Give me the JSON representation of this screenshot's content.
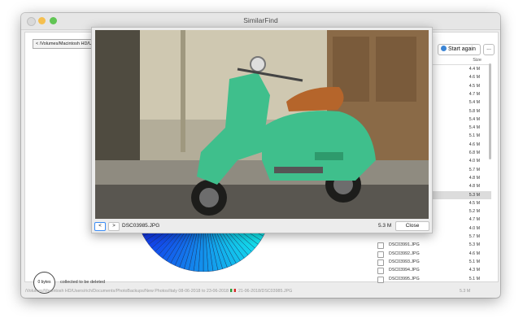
{
  "window": {
    "title": "SimilarFind"
  },
  "toolbar": {
    "path_label": "< /Volumes/Macintosh HD/Us",
    "start_label": "Start again",
    "more_label": "..."
  },
  "file_list": {
    "size_header": "Size",
    "rows": [
      {
        "name": "",
        "size": "4.4 M"
      },
      {
        "name": "",
        "size": "4.6 M"
      },
      {
        "name": "",
        "size": "4.5 M"
      },
      {
        "name": "",
        "size": "4.7 M"
      },
      {
        "name": "",
        "size": "5.4 M"
      },
      {
        "name": "",
        "size": "5.8 M"
      },
      {
        "name": "",
        "size": "5.4 M"
      },
      {
        "name": "",
        "size": "5.4 M"
      },
      {
        "name": "",
        "size": "5.1 M"
      },
      {
        "name": "",
        "size": "4.6 M"
      },
      {
        "name": "",
        "size": "6.8 M"
      },
      {
        "name": "",
        "size": "4.0 M"
      },
      {
        "name": "",
        "size": "5.7 M"
      },
      {
        "name": "",
        "size": "4.8 M"
      },
      {
        "name": "",
        "size": "4.8 M"
      },
      {
        "name": "",
        "size": "5.3 M"
      },
      {
        "name": "",
        "size": "4.5 M"
      },
      {
        "name": "",
        "size": "5.2 M"
      },
      {
        "name": "",
        "size": "4.7 M"
      },
      {
        "name": "",
        "size": "4.0 M"
      },
      {
        "name": "",
        "size": "5.7 M"
      },
      {
        "name": "DSC03991.JPG",
        "size": "5.3 M"
      },
      {
        "name": "DSC03992.JPG",
        "size": "4.6 M"
      },
      {
        "name": "DSC03993.JPG",
        "size": "5.1 M"
      },
      {
        "name": "DSC03994.JPG",
        "size": "4.3 M"
      },
      {
        "name": "DSC03995.JPG",
        "size": "5.1 M"
      }
    ],
    "selected_index": 15
  },
  "summary": {
    "bytes_label": "0 bytes",
    "collected_label": "collected to be deleted"
  },
  "status_bar": {
    "path": "/Volumes/Macintosh HD/Users/rich/Documents/PhotoBackups/New Photos/Italy 08-06-2018 to 23-06-2018",
    "path_tail": "21-06-2018/DSC03985.JPG",
    "size": "5.3 M"
  },
  "preview": {
    "prev_label": "<",
    "next_label": ">",
    "filename": "DSC03985.JPG",
    "size": "5.3 M",
    "close_label": "Close"
  },
  "colors": {
    "accent_blue": "#3a8cf5",
    "selection": "#dcdcdc",
    "scooter": "#3fbf8c"
  },
  "icons": {
    "start_again": "refresh-icon",
    "flag": "italy-flag-icon"
  }
}
